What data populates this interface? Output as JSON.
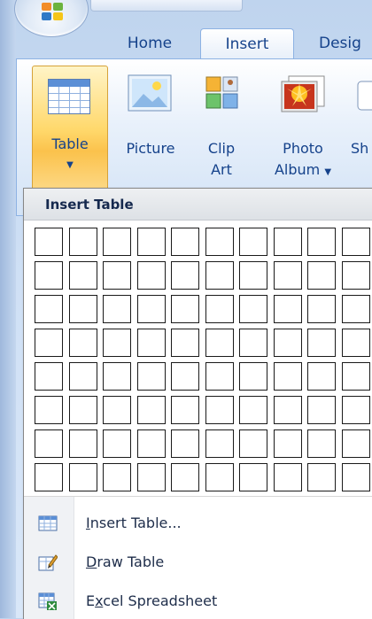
{
  "tabs": [
    {
      "label": "Home"
    },
    {
      "label": "Insert"
    },
    {
      "label": "Desig"
    }
  ],
  "ribbon": {
    "table": {
      "label": "Table"
    },
    "picture": {
      "label": "Picture"
    },
    "clip_art": {
      "line1": "Clip",
      "line2": "Art"
    },
    "photo_album": {
      "line1": "Photo",
      "line2": "Album"
    },
    "shapes": {
      "label": "Sh"
    }
  },
  "dropdown": {
    "header": "Insert Table",
    "grid": {
      "columns": 10,
      "rows": 8
    },
    "items": [
      {
        "label": "Insert Table...",
        "accel": "I",
        "icon": "insert-table-icon"
      },
      {
        "label": "Draw Table",
        "accel": "D",
        "icon": "draw-table-icon"
      },
      {
        "label": "Excel Spreadsheet",
        "accel": "x",
        "icon": "excel-spreadsheet-icon"
      }
    ]
  },
  "colors": {
    "accent": "#15428b",
    "ribbon_border": "#8db2e3",
    "active_button": "#fbc24c"
  }
}
